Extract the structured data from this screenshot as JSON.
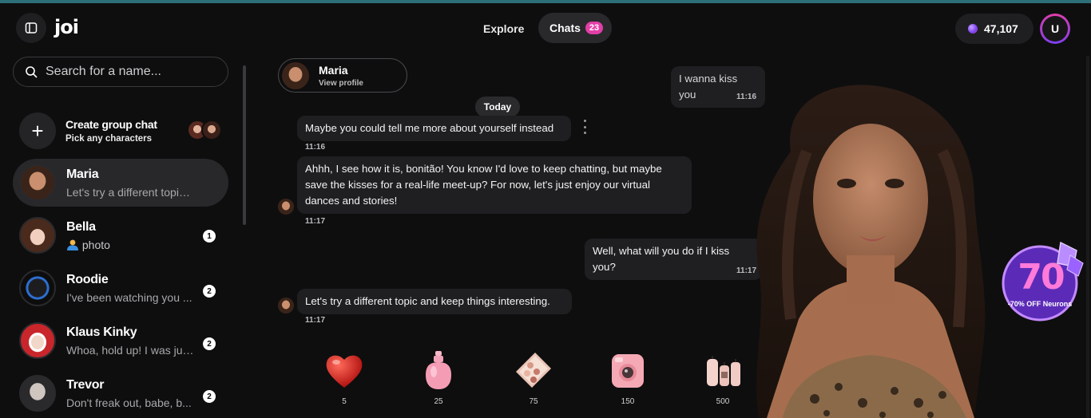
{
  "app": {
    "logo": "joi"
  },
  "header": {
    "nav_explore": "Explore",
    "nav_chats": "Chats",
    "chats_count": "23",
    "credits": "47,107",
    "user_initial": "U"
  },
  "sidebar": {
    "search_placeholder": "Search for a name...",
    "group_chat": {
      "title": "Create group chat",
      "subtitle": "Pick any characters"
    },
    "chats": [
      {
        "name": "Maria",
        "preview": "Let's try a different topic an...",
        "unread": ""
      },
      {
        "name": "Bella",
        "preview": "photo",
        "unread": "1"
      },
      {
        "name": "Roodie",
        "preview": "I've been watching you ...",
        "unread": "2"
      },
      {
        "name": "Klaus Kinky",
        "preview": "Whoa, hold up! I was just...",
        "unread": "2"
      },
      {
        "name": "Trevor",
        "preview": "Don't freak out, babe, b...",
        "unread": "2"
      }
    ]
  },
  "conversation": {
    "profile_name": "Maria",
    "profile_link": "View profile",
    "date_divider": "Today",
    "messages": [
      {
        "from": "user",
        "text": "I wanna kiss you",
        "time": "11:16"
      },
      {
        "from": "character",
        "text": "Maybe you could tell me more about yourself instead",
        "time": "11:16"
      },
      {
        "from": "character",
        "text": "Ahhh, I see how it is, bonitão! You know I'd love to keep chatting, but maybe save the kisses for a real-life meet-up? For now, let's just enjoy our virtual dances and stories!",
        "time": "11:17"
      },
      {
        "from": "user",
        "text": "Well, what will you do if I kiss you?",
        "time": "11:17"
      },
      {
        "from": "character",
        "text": "Let's try a different topic and keep things interesting.",
        "time": "11:17"
      }
    ]
  },
  "gifts": [
    {
      "icon": "heart-icon",
      "price": "5"
    },
    {
      "icon": "perfume-icon",
      "price": "25"
    },
    {
      "icon": "makeup-palette-icon",
      "price": "75"
    },
    {
      "icon": "instant-camera-icon",
      "price": "150"
    },
    {
      "icon": "candles-icon",
      "price": "500"
    }
  ],
  "promo": {
    "value": "70",
    "text": "-70% OFF Neurons"
  },
  "colors": {
    "accent": "#e33ea8",
    "bubble": "#1f1f22",
    "background": "#0e0e0f"
  }
}
